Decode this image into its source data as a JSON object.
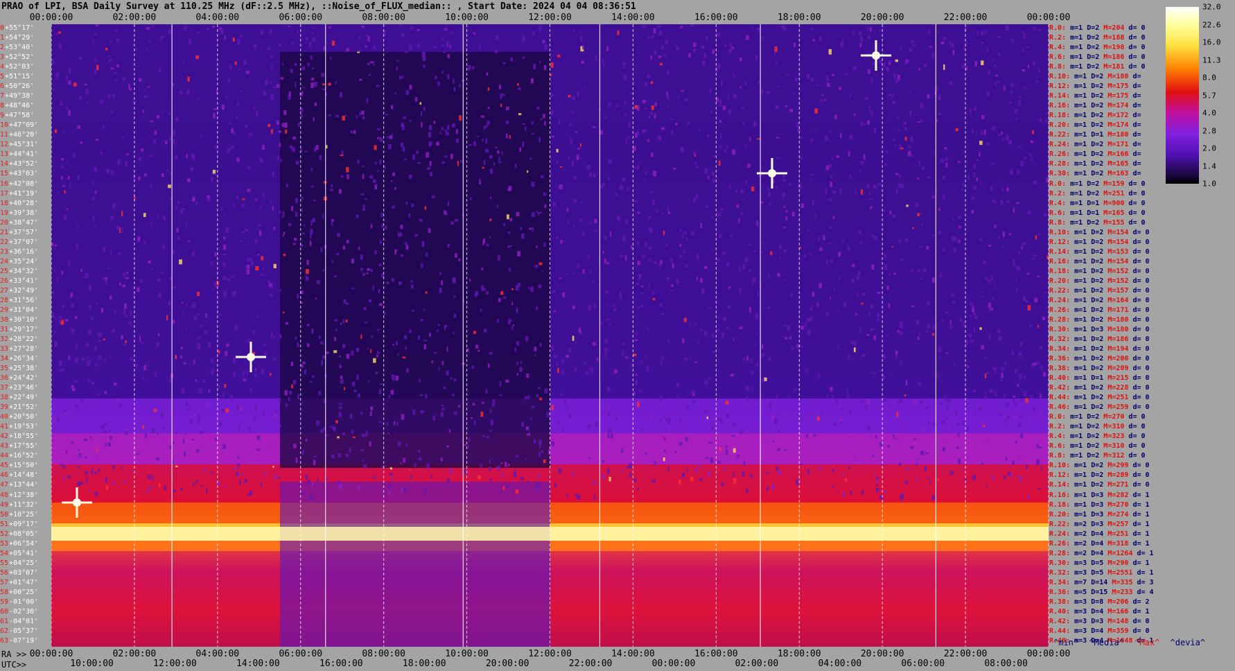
{
  "title": "PRAO of LPI, BSA Daily Survey at 110.25 MHz (dF::2.5 MHz), ::Noise_of_FLUX_median:: , Start Date: 2024 04 04 08:36:51",
  "x_label": "RA >>",
  "utc_label": "UTC>>",
  "colors": {
    "background": "#a4a4a4",
    "dec_label_num": "#e02020",
    "stats_red": "#e01010",
    "stats_blue": "#00006a"
  },
  "legend": {
    "min": "^min^",
    "median": "^Media^",
    "max": "^Max^",
    "devia": "^devia^"
  },
  "chart_data": {
    "type": "heatmap",
    "colormap": "black-purple-red-yellow-white",
    "top_ticks": [
      "00:00:00",
      "02:00:00",
      "04:00:00",
      "06:00:00",
      "08:00:00",
      "10:00:00",
      "12:00:00",
      "14:00:00",
      "16:00:00",
      "18:00:00",
      "20:00:00",
      "22:00:00",
      "00:00:00"
    ],
    "bottom_ra_ticks": [
      "00:00:00",
      "02:00:00",
      "04:00:00",
      "06:00:00",
      "08:00:00",
      "10:00:00",
      "12:00:00",
      "14:00:00",
      "16:00:00",
      "18:00:00",
      "20:00:00",
      "22:00:00",
      "00:00:00"
    ],
    "utc_ticks": [
      "10:00:00",
      "12:00:00",
      "14:00:00",
      "16:00:00",
      "18:00:00",
      "20:00:00",
      "22:00:00",
      "00:00:00",
      "02:00:00",
      "04:00:00",
      "06:00:00",
      "08:00:00"
    ],
    "colorbar": {
      "ticks": [
        "32.0",
        "22.6",
        "16.0",
        "11.3",
        "8.0",
        "5.7",
        "4.0",
        "2.8",
        "2.0",
        "1.4",
        "1.0"
      ]
    },
    "declinations": [
      {
        "n": "0",
        "dec": "+55°17'"
      },
      {
        "n": "1",
        "dec": "+54°29'"
      },
      {
        "n": "2",
        "dec": "+53°40'"
      },
      {
        "n": "3",
        "dec": "+52°52'"
      },
      {
        "n": "4",
        "dec": "+52°03'"
      },
      {
        "n": "5",
        "dec": "+51°15'"
      },
      {
        "n": "6",
        "dec": "+50°26'"
      },
      {
        "n": "7",
        "dec": "+49°38'"
      },
      {
        "n": "8",
        "dec": "+48°46'"
      },
      {
        "n": "9",
        "dec": "+47°58'"
      },
      {
        "n": "10",
        "dec": "+47°09'"
      },
      {
        "n": "11",
        "dec": "+46°20'"
      },
      {
        "n": "12",
        "dec": "+45°31'"
      },
      {
        "n": "13",
        "dec": "+44°41'"
      },
      {
        "n": "14",
        "dec": "+43°52'"
      },
      {
        "n": "15",
        "dec": "+43°03'"
      },
      {
        "n": "16",
        "dec": "+42°08'"
      },
      {
        "n": "17",
        "dec": "+41°19'"
      },
      {
        "n": "18",
        "dec": "+40°28'"
      },
      {
        "n": "19",
        "dec": "+39°38'"
      },
      {
        "n": "20",
        "dec": "+38°47'"
      },
      {
        "n": "21",
        "dec": "+37°57'"
      },
      {
        "n": "22",
        "dec": "+37°07'"
      },
      {
        "n": "23",
        "dec": "+36°16'"
      },
      {
        "n": "24",
        "dec": "+35°24'"
      },
      {
        "n": "25",
        "dec": "+34°32'"
      },
      {
        "n": "26",
        "dec": "+33°41'"
      },
      {
        "n": "27",
        "dec": "+32°49'"
      },
      {
        "n": "28",
        "dec": "+31°56'"
      },
      {
        "n": "29",
        "dec": "+31°04'"
      },
      {
        "n": "30",
        "dec": "+30°10'"
      },
      {
        "n": "31",
        "dec": "+29°17'"
      },
      {
        "n": "32",
        "dec": "+28°22'"
      },
      {
        "n": "33",
        "dec": "+27°28'"
      },
      {
        "n": "34",
        "dec": "+26°34'"
      },
      {
        "n": "35",
        "dec": "+25°38'"
      },
      {
        "n": "36",
        "dec": "+24°42'"
      },
      {
        "n": "37",
        "dec": "+23°46'"
      },
      {
        "n": "38",
        "dec": "+22°49'"
      },
      {
        "n": "39",
        "dec": "+21°52'"
      },
      {
        "n": "40",
        "dec": "+20°50'"
      },
      {
        "n": "41",
        "dec": "+19°53'"
      },
      {
        "n": "42",
        "dec": "+18°55'"
      },
      {
        "n": "43",
        "dec": "+17°55'"
      },
      {
        "n": "44",
        "dec": "+16°52'"
      },
      {
        "n": "45",
        "dec": "+15°50'"
      },
      {
        "n": "46",
        "dec": "+14°48'"
      },
      {
        "n": "47",
        "dec": "+13°44'"
      },
      {
        "n": "48",
        "dec": "+12°38'"
      },
      {
        "n": "49",
        "dec": "+11°32'"
      },
      {
        "n": "50",
        "dec": "+10°25'"
      },
      {
        "n": "51",
        "dec": "+09°17'"
      },
      {
        "n": "52",
        "dec": "+08°05'"
      },
      {
        "n": "53",
        "dec": "+06°54'"
      },
      {
        "n": "54",
        "dec": "+05°41'"
      },
      {
        "n": "55",
        "dec": "+04°25'"
      },
      {
        "n": "56",
        "dec": "+03°07'"
      },
      {
        "n": "57",
        "dec": "+01°47'"
      },
      {
        "n": "58",
        "dec": "+00°25'"
      },
      {
        "n": "59",
        "dec": "-01°00'"
      },
      {
        "n": "60",
        "dec": "-02°30'"
      },
      {
        "n": "61",
        "dec": "-04°01'"
      },
      {
        "n": "62",
        "dec": "-05°37'"
      },
      {
        "n": "63",
        "dec": "-07°19'"
      }
    ],
    "stats": [
      [
        "R.0:",
        "m=1",
        "D=2",
        "M=204",
        "d= 0"
      ],
      [
        "R.2:",
        "m=1",
        "D=2",
        "M=188",
        "d= 0"
      ],
      [
        "R.4:",
        "m=1",
        "D=2",
        "M=198",
        "d= 0"
      ],
      [
        "R.6:",
        "m=1",
        "D=2",
        "M=186",
        "d= 0"
      ],
      [
        "R.8:",
        "m=1",
        "D=2",
        "M=181",
        "d= 0"
      ],
      [
        "R.10:",
        "m=1",
        "D=2",
        "M=180",
        "d="
      ],
      [
        "R.12:",
        "m=1",
        "D=2",
        "M=175",
        "d="
      ],
      [
        "R.14:",
        "m=1",
        "D=2",
        "M=175",
        "d="
      ],
      [
        "R.16:",
        "m=1",
        "D=2",
        "M=174",
        "d="
      ],
      [
        "R.18:",
        "m=1",
        "D=2",
        "M=172",
        "d="
      ],
      [
        "R.20:",
        "m=1",
        "D=2",
        "M=174",
        "d="
      ],
      [
        "R.22:",
        "m=1",
        "D=1",
        "M=180",
        "d="
      ],
      [
        "R.24:",
        "m=1",
        "D=2",
        "M=171",
        "d="
      ],
      [
        "R.26:",
        "m=1",
        "D=2",
        "M=166",
        "d="
      ],
      [
        "R.28:",
        "m=1",
        "D=2",
        "M=165",
        "d="
      ],
      [
        "R.30:",
        "m=1",
        "D=2",
        "M=163",
        "d="
      ],
      [
        "R.0:",
        "m=1",
        "D=2",
        "M=159",
        "d= 0"
      ],
      [
        "R.2:",
        "m=1",
        "D=2",
        "M=251",
        "d= 0"
      ],
      [
        "R.4:",
        "m=1",
        "D=1",
        "M=900",
        "d= 0"
      ],
      [
        "R.6:",
        "m=1",
        "D=1",
        "M=165",
        "d= 0"
      ],
      [
        "R.8:",
        "m=1",
        "D=2",
        "M=155",
        "d= 0"
      ],
      [
        "R.10:",
        "m=1",
        "D=2",
        "M=154",
        "d= 0"
      ],
      [
        "R.12:",
        "m=1",
        "D=2",
        "M=154",
        "d= 0"
      ],
      [
        "R.14:",
        "m=1",
        "D=2",
        "M=153",
        "d= 0"
      ],
      [
        "R.16:",
        "m=1",
        "D=2",
        "M=154",
        "d= 0"
      ],
      [
        "R.18:",
        "m=1",
        "D=2",
        "M=152",
        "d= 0"
      ],
      [
        "R.20:",
        "m=1",
        "D=2",
        "M=152",
        "d= 0"
      ],
      [
        "R.22:",
        "m=1",
        "D=2",
        "M=157",
        "d= 0"
      ],
      [
        "R.24:",
        "m=1",
        "D=2",
        "M=164",
        "d= 0"
      ],
      [
        "R.26:",
        "m=1",
        "D=2",
        "M=171",
        "d= 0"
      ],
      [
        "R.28:",
        "m=1",
        "D=2",
        "M=180",
        "d= 0"
      ],
      [
        "R.30:",
        "m=1",
        "D=3",
        "M=180",
        "d= 0"
      ],
      [
        "R.32:",
        "m=1",
        "D=2",
        "M=186",
        "d= 0"
      ],
      [
        "R.34:",
        "m=1",
        "D=2",
        "M=194",
        "d= 0"
      ],
      [
        "R.36:",
        "m=1",
        "D=2",
        "M=200",
        "d= 0"
      ],
      [
        "R.38:",
        "m=1",
        "D=2",
        "M=209",
        "d= 0"
      ],
      [
        "R.40:",
        "m=1",
        "D=1",
        "M=215",
        "d= 0"
      ],
      [
        "R.42:",
        "m=1",
        "D=2",
        "M=228",
        "d= 0"
      ],
      [
        "R.44:",
        "m=1",
        "D=2",
        "M=251",
        "d= 0"
      ],
      [
        "R.46:",
        "m=1",
        "D=2",
        "M=259",
        "d= 0"
      ],
      [
        "R.0:",
        "m=1",
        "D=2",
        "M=270",
        "d= 0"
      ],
      [
        "R.2:",
        "m=1",
        "D=2",
        "M=310",
        "d= 0"
      ],
      [
        "R.4:",
        "m=1",
        "D=2",
        "M=323",
        "d= 0"
      ],
      [
        "R.6:",
        "m=1",
        "D=2",
        "M=310",
        "d= 0"
      ],
      [
        "R.8:",
        "m=1",
        "D=2",
        "M=312",
        "d= 0"
      ],
      [
        "R.10:",
        "m=1",
        "D=2",
        "M=299",
        "d= 0"
      ],
      [
        "R.12:",
        "m=1",
        "D=2",
        "M=289",
        "d= 0"
      ],
      [
        "R.14:",
        "m=1",
        "D=2",
        "M=271",
        "d= 0"
      ],
      [
        "R.16:",
        "m=1",
        "D=3",
        "M=282",
        "d= 1"
      ],
      [
        "R.18:",
        "m=1",
        "D=3",
        "M=270",
        "d= 1"
      ],
      [
        "R.20:",
        "m=1",
        "D=3",
        "M=274",
        "d= 1"
      ],
      [
        "R.22:",
        "m=2",
        "D=3",
        "M=257",
        "d= 1"
      ],
      [
        "R.24:",
        "m=2",
        "D=4",
        "M=251",
        "d= 1"
      ],
      [
        "R.26:",
        "m=2",
        "D=4",
        "M=318",
        "d= 1"
      ],
      [
        "R.28:",
        "m=2",
        "D=4",
        "M=1264",
        "d= 1"
      ],
      [
        "R.30:",
        "m=3",
        "D=5",
        "M=290",
        "d= 1"
      ],
      [
        "R.32:",
        "m=3",
        "D=5",
        "M=2551",
        "d= 1"
      ],
      [
        "R.34:",
        "m=7",
        "D=14",
        "M=335",
        "d= 3"
      ],
      [
        "R.36:",
        "m=5",
        "D=15",
        "M=233",
        "d= 4"
      ],
      [
        "R.38:",
        "m=3",
        "D=8",
        "M=206",
        "d= 2"
      ],
      [
        "R.40:",
        "m=3",
        "D=4",
        "M=166",
        "d= 1"
      ],
      [
        "R.42:",
        "m=3",
        "D=3",
        "M=148",
        "d= 0"
      ],
      [
        "R.44:",
        "m=3",
        "D=4",
        "M=359",
        "d= 0"
      ],
      [
        "R.46:",
        "m=3",
        "D=4",
        "M=1848",
        "d= 1"
      ]
    ]
  }
}
